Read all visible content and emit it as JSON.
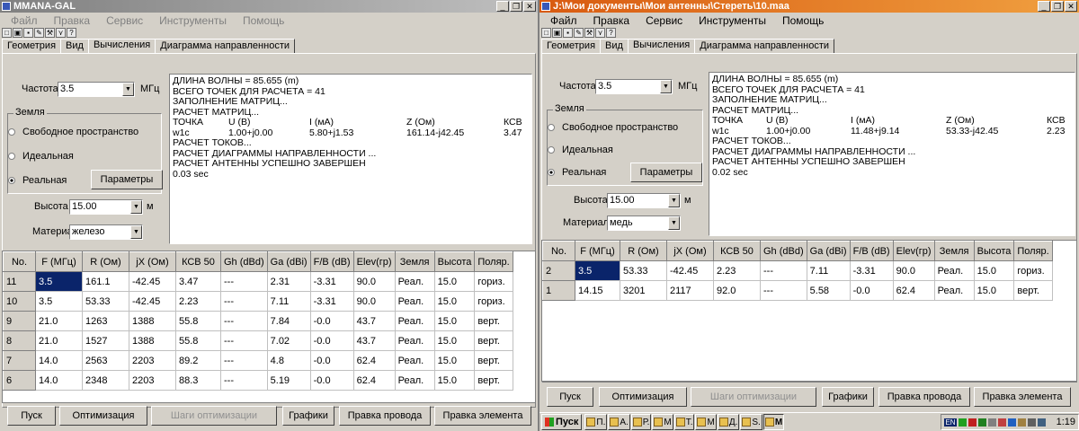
{
  "left": {
    "title": "MMANA-GAL",
    "menu": [
      "Файл",
      "Правка",
      "Сервис",
      "Инструменты",
      "Помощь"
    ],
    "tabs": [
      "Геометрия",
      "Вид",
      "Вычисления",
      "Диаграмма направленности"
    ],
    "active_tab": 2,
    "freq_label": "Частота",
    "freq_value": "3.5",
    "freq_unit": "МГц",
    "ground_group": "Земля",
    "ground_options": [
      "Свободное пространство",
      "Идеальная",
      "Реальная"
    ],
    "ground_selected": 2,
    "params_button": "Параметры",
    "height_label": "Высота",
    "height_value": "15.00",
    "height_unit": "м",
    "material_label": "Материал",
    "material_value": "железо",
    "output": {
      "lines_before": [
        "ДЛИНА ВОЛНЫ = 85.655 (m)",
        "ВСЕГО ТОЧЕК ДЛЯ РАСЧЕТА = 41",
        "ЗАПОЛНЕНИЕ МАТРИЦ...",
        "РАСЧЕТ МАТРИЦ..."
      ],
      "header": [
        "ТОЧКА",
        "U (В)",
        "I (мА)",
        "Z (Ом)",
        "КСВ"
      ],
      "row": [
        "w1c",
        "1.00+j0.00",
        "5.80+j1.53",
        "161.14-j42.45",
        "3.47"
      ],
      "lines_after": [
        "РАСЧЕТ ТОКОВ...",
        "РАСЧЕТ ДИАГРАММЫ НАПРАВЛЕННОСТИ ...",
        "РАСЧЕТ АНТЕННЫ УСПЕШНО ЗАВЕРШЕН",
        "0.03 sec"
      ]
    },
    "table": {
      "columns": [
        "No.",
        "F (МГц)",
        "R (Ом)",
        "jX (Ом)",
        "КСВ 50",
        "Gh (dBd)",
        "Ga (dBi)",
        "F/B (dB)",
        "Elev(гр)",
        "Земля",
        "Высота",
        "Поляр."
      ],
      "rows": [
        [
          "11",
          "3.5",
          "161.1",
          "-42.45",
          "3.47",
          "---",
          "2.31",
          "-3.31",
          "90.0",
          "Реал.",
          "15.0",
          "гориз."
        ],
        [
          "10",
          "3.5",
          "53.33",
          "-42.45",
          "2.23",
          "---",
          "7.11",
          "-3.31",
          "90.0",
          "Реал.",
          "15.0",
          "гориз."
        ],
        [
          "9",
          "21.0",
          "1263",
          "1388",
          "55.8",
          "---",
          "7.84",
          "-0.0",
          "43.7",
          "Реал.",
          "15.0",
          "верт."
        ],
        [
          "8",
          "21.0",
          "1527",
          "1388",
          "55.8",
          "---",
          "7.02",
          "-0.0",
          "43.7",
          "Реал.",
          "15.0",
          "верт."
        ],
        [
          "7",
          "14.0",
          "2563",
          "2203",
          "89.2",
          "---",
          "4.8",
          "-0.0",
          "62.4",
          "Реал.",
          "15.0",
          "верт."
        ],
        [
          "6",
          "14.0",
          "2348",
          "2203",
          "88.3",
          "---",
          "5.19",
          "-0.0",
          "62.4",
          "Реал.",
          "15.0",
          "верт."
        ]
      ]
    },
    "buttons": [
      "Пуск",
      "Оптимизация",
      "Шаги оптимизации",
      "Графики",
      "Правка провода",
      "Правка элемента"
    ]
  },
  "right": {
    "title": "J:\\Мои документы\\Мои антенны\\Стереть\\10.maa",
    "menu": [
      "Файл",
      "Правка",
      "Сервис",
      "Инструменты",
      "Помощь"
    ],
    "tabs": [
      "Геометрия",
      "Вид",
      "Вычисления",
      "Диаграмма направленности"
    ],
    "active_tab": 2,
    "freq_label": "Частота",
    "freq_value": "3.5",
    "freq_unit": "МГц",
    "ground_group": "Земля",
    "ground_options": [
      "Свободное пространство",
      "Идеальная",
      "Реальная"
    ],
    "ground_selected": 2,
    "params_button": "Параметры",
    "height_label": "Высота",
    "height_value": "15.00",
    "height_unit": "м",
    "material_label": "Материал",
    "material_value": "медь",
    "output": {
      "lines_before": [
        "ДЛИНА ВОЛНЫ = 85.655 (m)",
        "ВСЕГО ТОЧЕК ДЛЯ РАСЧЕТА = 41",
        "ЗАПОЛНЕНИЕ МАТРИЦ...",
        "РАСЧЕТ МАТРИЦ..."
      ],
      "header": [
        "ТОЧКА",
        "U (В)",
        "I (мА)",
        "Z (Ом)",
        "КСВ"
      ],
      "row": [
        "w1c",
        "1.00+j0.00",
        "11.48+j9.14",
        "53.33-j42.45",
        "2.23"
      ],
      "lines_after": [
        "РАСЧЕТ ТОКОВ...",
        "РАСЧЕТ ДИАГРАММЫ НАПРАВЛЕННОСТИ ...",
        "РАСЧЕТ АНТЕННЫ УСПЕШНО ЗАВЕРШЕН",
        "0.02 sec"
      ]
    },
    "table": {
      "columns": [
        "No.",
        "F (МГц)",
        "R (Ом)",
        "jX (Ом)",
        "КСВ 50",
        "Gh (dBd)",
        "Ga (dBi)",
        "F/B (dB)",
        "Elev(гр)",
        "Земля",
        "Высота",
        "Поляр."
      ],
      "rows": [
        [
          "2",
          "3.5",
          "53.33",
          "-42.45",
          "2.23",
          "---",
          "7.11",
          "-3.31",
          "90.0",
          "Реал.",
          "15.0",
          "гориз."
        ],
        [
          "1",
          "14.15",
          "3201",
          "2117",
          "92.0",
          "---",
          "5.58",
          "-0.0",
          "62.4",
          "Реал.",
          "15.0",
          "верт."
        ]
      ]
    },
    "buttons": [
      "Пуск",
      "Оптимизация",
      "Шаги оптимизации",
      "Графики",
      "Правка провода",
      "Правка элемента"
    ]
  },
  "taskbar": {
    "start_label": "Пуск",
    "tasks": [
      "П.",
      "А.",
      "Р.",
      "М",
      "Т.",
      "М",
      "Д.",
      "S.",
      "М"
    ],
    "active_task": 8,
    "lang": "EN",
    "clock": "1:19"
  }
}
